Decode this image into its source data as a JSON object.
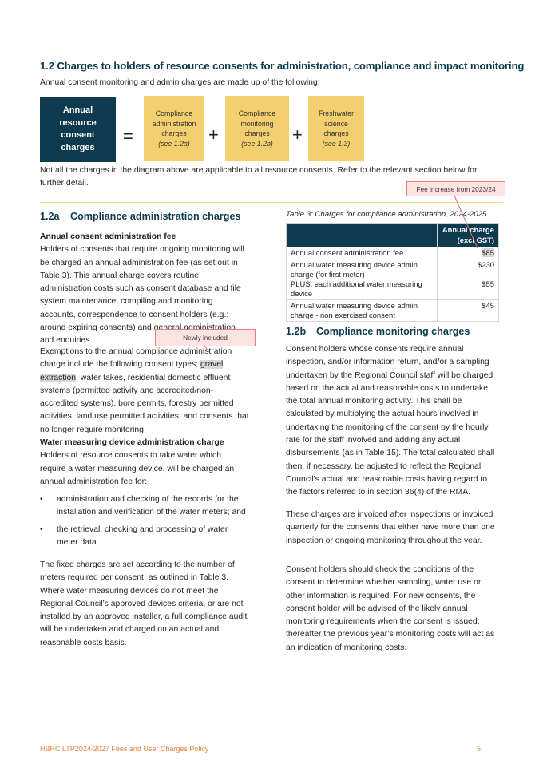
{
  "section": {
    "heading": "1.2 Charges to holders of resource consents for administration, compliance and impact monitoring",
    "intro": "Annual consent monitoring and admin charges are made up of the following:",
    "diagram": {
      "total_box": [
        "Annual",
        "resource",
        "consent",
        "charges"
      ],
      "equals_sign": "=",
      "plus_sign": "+",
      "components": [
        {
          "lines": [
            "Compliance",
            "administration",
            "charges"
          ],
          "ref": "(see 1.2a)"
        },
        {
          "lines": [
            "Compliance",
            "monitoring",
            "charges"
          ],
          "ref": "(see 1.2b)"
        },
        {
          "lines": [
            "Freshwater",
            "science",
            "charges"
          ],
          "ref": "(see 1.3)"
        }
      ]
    },
    "note": "Not all the charges in the diagram above are applicable to all resource consents. Refer to the relevant section below for further detail."
  },
  "annotations": {
    "fee_increase": "Fee increase from 2023/24",
    "newly_included": "Newly included"
  },
  "sub_a": {
    "number": "1.2a",
    "title": "Compliance administration charges",
    "fee_subhead": "Annual consent administration fee",
    "fee_text": "Holders of consents that require ongoing monitoring will be charged an annual administration fee (as set out in Table 3). This annual charge covers routine administration costs such as consent database and file system maintenance, compiling and monitoring accounts, correspondence to consent holders (e.g.: around expiring consents) and general administration and enquiries.",
    "exemptions_before": "Exemptions to the annual compliance administration charge include the following consent types; ",
    "exemptions_highlight": "gravel extraction",
    "exemptions_after": ", water takes, residential domestic effluent systems (permitted activity and accredited/non-accredited systems), bore permits, forestry permitted activities, land use permitted activities, and consents that no longer require monitoring.",
    "wmd_subhead": "Water measuring device administration charge",
    "wmd_text": "Holders of resource consents to take water which require a water measuring device, will be charged an annual administration fee for:",
    "bullet_char": "•",
    "bullets": [
      "administration and checking of the records for the installation and verification of the water meters; and",
      "the retrieval, checking and processing of water meter data."
    ],
    "fixed_text": "The fixed charges are set according to the number of meters required per consent, as outlined in Table 3. Where water measuring devices do not meet the Regional Council’s approved devices criteria, or are not installed by an approved installer, a full compliance audit will be undertaken and charged on an actual and reasonable costs basis."
  },
  "table3": {
    "caption": "Table 3: Charges for compliance administration, 2024-2025",
    "header_left": "",
    "header_right_1": "Annual charge",
    "header_right_2": "(excl GST)",
    "rows": [
      {
        "item": "Annual consent administration fee",
        "amount": "$85"
      },
      {
        "item": "Annual water measuring device admin charge (for first meter)",
        "amount": "$230"
      },
      {
        "item": "PLUS, each additional water measuring device",
        "amount": "$55"
      },
      {
        "item": "Annual water measuring device admin charge - non exercised consent",
        "amount": "$45"
      }
    ]
  },
  "sub_b": {
    "number": "1.2b",
    "title": "Compliance monitoring charges",
    "paragraphs": [
      "Consent holders whose consents require annual inspection, and/or information return, and/or a sampling undertaken by the Regional Council staff will be charged based on the actual and reasonable costs to undertake the total annual monitoring activity. This shall be calculated by multiplying the actual hours involved in undertaking the monitoring of the consent by the hourly rate for the staff involved and adding any actual disbursements (as in Table 15). The total calculated shall then, if necessary, be adjusted to reflect the Regional Council's actual and reasonable costs having regard to the factors referred to in section 36(4) of the RMA.",
      "These charges are invoiced after inspections or invoiced quarterly for the consents that either have more than one inspection or ongoing monitoring throughout the year.",
      "Consent holders should check the conditions of the consent to determine whether sampling, water use or other information is required. For new consents, the consent holder will be advised of the likely annual monitoring requirements when the consent is issued; thereafter the previous year’s monitoring costs will act as an indication of monitoring costs."
    ]
  },
  "footer": {
    "title": "HBRC LTP2024-2027 Fees and User Charges Policy",
    "page": "5"
  }
}
